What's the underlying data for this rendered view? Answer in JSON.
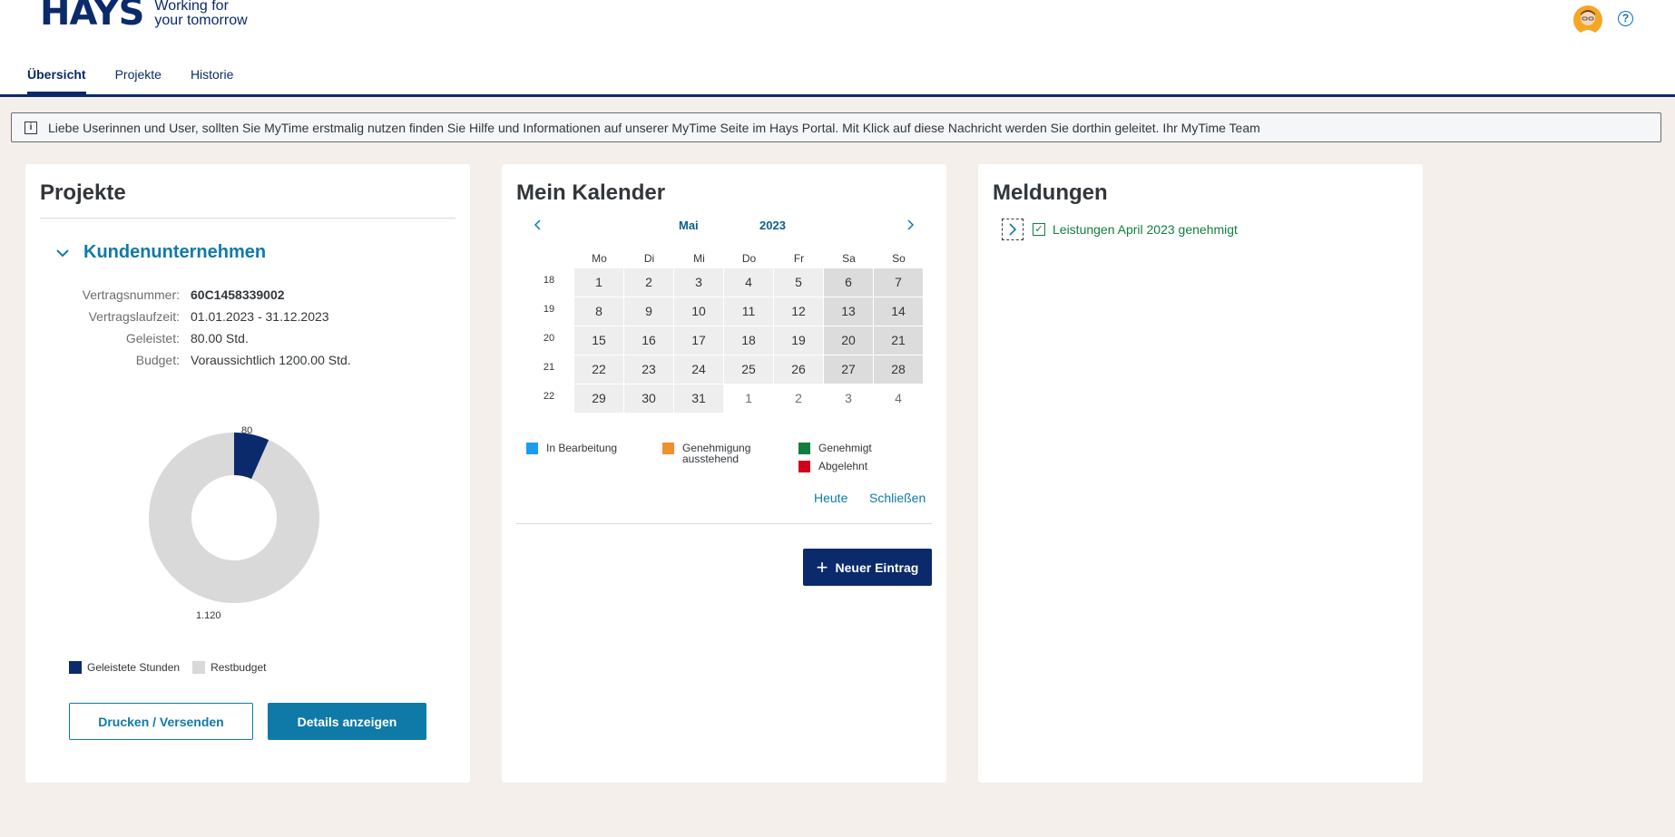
{
  "header": {
    "logo_word": "HAYS",
    "logo_tagline_1": "Working for",
    "logo_tagline_2": "your tomorrow",
    "help_symbol": "?",
    "tabs": [
      {
        "label": "Übersicht"
      },
      {
        "label": "Projekte"
      },
      {
        "label": "Historie"
      }
    ],
    "active_tab": "Übersicht",
    "accent_color": "#0a2a6b"
  },
  "message_strip": {
    "icon": "info-icon",
    "icon_symbol": "i",
    "text": "Liebe Userinnen und User, sollten Sie MyTime erstmalig nutzen finden Sie Hilfe und Informationen auf unserer MyTime Seite im Hays Portal. Mit Klick auf diese Nachricht werden Sie dorthin geleitet. Ihr MyTime Team"
  },
  "projekte": {
    "title": "Projekte",
    "section_title": "Kundenunternehmen",
    "fields": [
      {
        "label": "Vertragsnummer:",
        "value": "60C1458339002"
      },
      {
        "label": "Vertragslaufzeit:",
        "value": "01.01.2023 - 31.12.2023"
      },
      {
        "label": "Geleistet:",
        "value": "80.00 Std."
      },
      {
        "label": "Budget:",
        "value": "Voraussichtlich 1200.00 Std."
      }
    ],
    "chart_data": {
      "type": "pie",
      "donut": true,
      "categories": [
        "Geleistete Stunden",
        "Restbudget"
      ],
      "values": [
        80,
        1120
      ],
      "value_labels": [
        "80",
        "1.120"
      ],
      "colors": [
        "#0a2a6b",
        "#d9d9d9"
      ],
      "legend_position": "bottom-left"
    },
    "print_button": "Drucken / Versenden",
    "details_button": "Details anzeigen"
  },
  "kalender": {
    "title": "Mein Kalender",
    "month": "Mai",
    "year": "2023",
    "day_names": [
      "Mo",
      "Di",
      "Mi",
      "Do",
      "Fr",
      "Sa",
      "So"
    ],
    "weeks": [
      {
        "week": "18",
        "days": [
          {
            "d": "1",
            "t": "n"
          },
          {
            "d": "2",
            "t": "n"
          },
          {
            "d": "3",
            "t": "n"
          },
          {
            "d": "4",
            "t": "n"
          },
          {
            "d": "5",
            "t": "n"
          },
          {
            "d": "6",
            "t": "w"
          },
          {
            "d": "7",
            "t": "w"
          }
        ]
      },
      {
        "week": "19",
        "days": [
          {
            "d": "8",
            "t": "n"
          },
          {
            "d": "9",
            "t": "n"
          },
          {
            "d": "10",
            "t": "n"
          },
          {
            "d": "11",
            "t": "n"
          },
          {
            "d": "12",
            "t": "n"
          },
          {
            "d": "13",
            "t": "w"
          },
          {
            "d": "14",
            "t": "w"
          }
        ]
      },
      {
        "week": "20",
        "days": [
          {
            "d": "15",
            "t": "n"
          },
          {
            "d": "16",
            "t": "n"
          },
          {
            "d": "17",
            "t": "n"
          },
          {
            "d": "18",
            "t": "n"
          },
          {
            "d": "19",
            "t": "n"
          },
          {
            "d": "20",
            "t": "w"
          },
          {
            "d": "21",
            "t": "w"
          }
        ]
      },
      {
        "week": "21",
        "days": [
          {
            "d": "22",
            "t": "n"
          },
          {
            "d": "23",
            "t": "n"
          },
          {
            "d": "24",
            "t": "n"
          },
          {
            "d": "25",
            "t": "n"
          },
          {
            "d": "26",
            "t": "n"
          },
          {
            "d": "27",
            "t": "w"
          },
          {
            "d": "28",
            "t": "w"
          }
        ]
      },
      {
        "week": "22",
        "days": [
          {
            "d": "29",
            "t": "n"
          },
          {
            "d": "30",
            "t": "n"
          },
          {
            "d": "31",
            "t": "n"
          },
          {
            "d": "1",
            "t": "o"
          },
          {
            "d": "2",
            "t": "o"
          },
          {
            "d": "3",
            "t": "o"
          },
          {
            "d": "4",
            "t": "o"
          }
        ]
      }
    ],
    "legend": [
      {
        "label": "In Bearbeitung",
        "color": "#1a9cf0"
      },
      {
        "label": "Genehmigung ausstehend",
        "color": "#f0902b"
      },
      {
        "label": "Genehmigt",
        "color": "#107e3e"
      },
      {
        "label": "Abgelehnt",
        "color": "#d0021b"
      }
    ],
    "today_link": "Heute",
    "close_link": "Schließen",
    "new_entry_button": "Neuer Eintrag"
  },
  "meldungen": {
    "title": "Meldungen",
    "items": [
      {
        "text": "Leistungen April 2023 genehmigt",
        "status_color": "#107e3e"
      }
    ]
  }
}
